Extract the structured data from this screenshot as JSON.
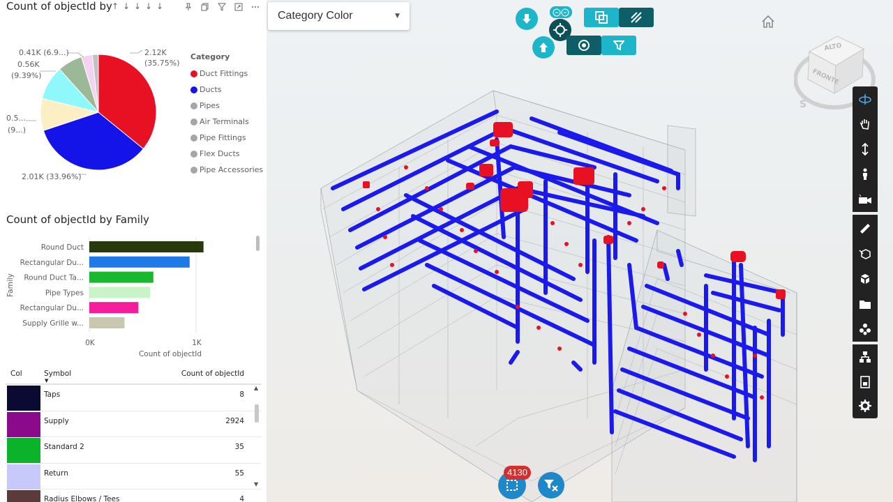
{
  "pie_visual": {
    "title": "Count of objectId by",
    "sort_glyphs": [
      "↑",
      "↓",
      "↓",
      "↓",
      "↓"
    ],
    "header_icons": [
      "pin-icon",
      "copy-icon",
      "filter-icon",
      "focus-mode-icon",
      "more-options-icon"
    ],
    "labels": {
      "duct_fittings": [
        "2.12K",
        "(35.75%)"
      ],
      "ducts": "2.01K (33.96%)",
      "pipes": [
        "0.5...",
        "(9...)"
      ],
      "air_terminals": [
        "0.56K",
        "(9.39%)"
      ],
      "pipe_fittings": "0.41K (6.9...)"
    },
    "legend_title": "Category",
    "legend": [
      {
        "label": "Duct Fittings",
        "color": "#e81123"
      },
      {
        "label": "Ducts",
        "color": "#1414e8"
      },
      {
        "label": "Pipes",
        "color": "#a6a6a6"
      },
      {
        "label": "Air Terminals",
        "color": "#a6a6a6"
      },
      {
        "label": "Pipe Fittings",
        "color": "#a6a6a6"
      },
      {
        "label": "Flex Ducts",
        "color": "#a6a6a6"
      },
      {
        "label": "Pipe Accessories",
        "color": "#a6a6a6"
      }
    ]
  },
  "chart_data": [
    {
      "type": "pie",
      "title": "Count of objectId by",
      "categories": [
        "Duct Fittings",
        "Ducts",
        "Pipes",
        "Air Terminals",
        "Pipe Fittings",
        "Flex Ducts",
        "Pipe Accessories"
      ],
      "values": [
        2120,
        2010,
        530,
        560,
        410,
        180,
        100
      ],
      "colors": [
        "#e81123",
        "#1414e8",
        "#fdefc4",
        "#8ff8fb",
        "#9cb997",
        "#f3d2f2",
        "#c2c2c2"
      ],
      "legend": "right"
    },
    {
      "type": "bar",
      "orientation": "horizontal",
      "title": "Count of objectId by Family",
      "categories": [
        "Round Duct",
        "Rectangular Du...",
        "Round Duct Ta...",
        "Pipe Types",
        "Rectangular Du...",
        "Supply Grille w..."
      ],
      "values": [
        1070,
        940,
        600,
        570,
        460,
        330
      ],
      "colors": [
        "#283a0c",
        "#1f7ae8",
        "#1ab82e",
        "#c8f5c8",
        "#f51e9a",
        "#c8c8b0"
      ],
      "xlabel": "Count of objectId",
      "ylabel": "Family",
      "xticks": [
        "0K",
        "1K"
      ],
      "xlim": [
        0,
        1500
      ],
      "grid": true
    }
  ],
  "family_visual": {
    "title": "Count of objectId by Family",
    "ylabel": "Family",
    "xlabel": "Count of objectId",
    "xticks": [
      "0K",
      "1K"
    ]
  },
  "table": {
    "headers": {
      "col": "Col",
      "symbol": "Symbol",
      "count": "Count of objectId"
    },
    "rows": [
      {
        "color": "#0a0a33",
        "symbol": "Taps",
        "count": "8"
      },
      {
        "color": "#8b0a8b",
        "symbol": "Supply",
        "count": "2924"
      },
      {
        "color": "#0ab32a",
        "symbol": "Standard 2",
        "count": "35"
      },
      {
        "color": "#c6c9fa",
        "symbol": "Return",
        "count": "55"
      },
      {
        "color": "#5a3a3a",
        "symbol": "Radius Elbows / Tees",
        "count": "4"
      }
    ]
  },
  "viewer": {
    "dropdown_value": "Category Color",
    "selection_count": "4130",
    "viewcube_labels": {
      "top": "ALTO",
      "front": "FRONTE",
      "compass": "S"
    },
    "accent_teal": "#1db5c9",
    "dark_teal": "#0d5e66",
    "toolbar_icons": [
      "orbit-icon",
      "pan-icon",
      "zoom-icon",
      "first-person-icon",
      "camera-icon",
      "measure-icon",
      "section-icon",
      "explode-icon",
      "model-browser-icon",
      "properties-icon",
      "structure-icon",
      "document-icon",
      "settings-icon"
    ]
  }
}
